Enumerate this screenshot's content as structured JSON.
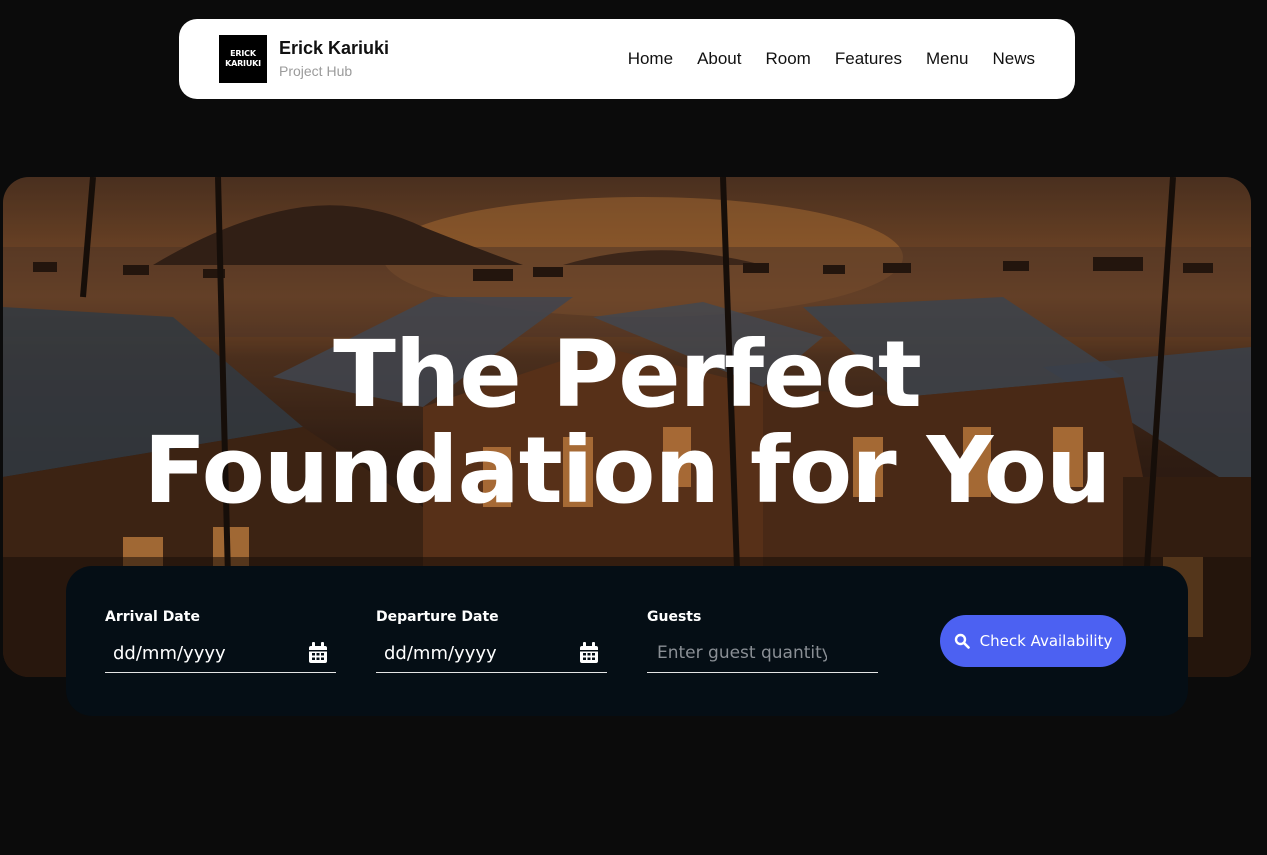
{
  "navbar": {
    "logo_line1": "ERICK",
    "logo_line2": "KARIUKI",
    "brand_name": "Erick Kariuki",
    "brand_sub": "Project Hub",
    "links": [
      "Home",
      "About",
      "Room",
      "Features",
      "Menu",
      "News"
    ]
  },
  "hero": {
    "title_line1": "The Perfect",
    "title_line2": "Foundation for You"
  },
  "booking": {
    "arrival_label": "Arrival Date",
    "arrival_value": "dd/mm/yyyy",
    "departure_label": "Departure Date",
    "departure_value": "dd/mm/yyyy",
    "guests_label": "Guests",
    "guests_placeholder": "Enter guest quantity",
    "button_label": "Check Availability",
    "button_icon": "search-icon",
    "date_icon": "calendar-icon"
  },
  "colors": {
    "page_bg": "#0b0b0b",
    "booking_bg": "#050e15",
    "button_accent": "#4c61f2",
    "navbar_bg": "#ffffff"
  }
}
